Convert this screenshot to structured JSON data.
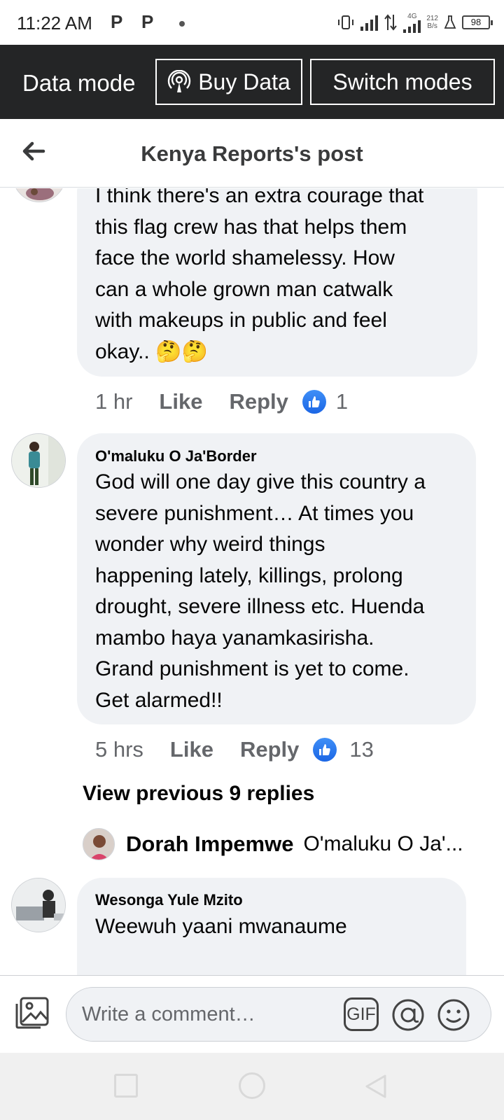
{
  "status_bar": {
    "time": "11:22 AM",
    "notif_icons": [
      "P",
      "P"
    ],
    "network_type": "4G",
    "speed_value": "212",
    "speed_unit": "B/s",
    "battery": "98"
  },
  "data_mode": {
    "label": "Data mode",
    "buy_label": "Buy Data",
    "switch_label": "Switch modes"
  },
  "header": {
    "title": "Kenya Reports's post",
    "back_icon": "arrow-left-icon"
  },
  "comments": [
    {
      "author": "",
      "lines": [
        "I think there's an extra courage that",
        "this flag crew has that helps them",
        "face the world shamelessy. How",
        "can a whole grown man catwalk",
        "with makeups in public and feel",
        "okay.."
      ],
      "emojis": [
        "🤔",
        "🤔"
      ],
      "time": "1 hr",
      "like_label": "Like",
      "reply_label": "Reply",
      "reactions": "1"
    },
    {
      "author": "O'maluku O Ja'Border",
      "lines": [
        "God will one day give this country a",
        "severe punishment… At times you",
        "wonder why weird things",
        "happening lately, killings, prolong",
        "drought, severe illness etc. Huenda",
        "mambo haya yanamkasirisha.",
        "Grand punishment is yet to come.",
        "Get alarmed!!"
      ],
      "time": "5 hrs",
      "like_label": "Like",
      "reply_label": "Reply",
      "reactions": "13"
    },
    {
      "author": "Wesonga Yule Mzito",
      "lines": [
        "Weewuh yaani mwanaume"
      ]
    }
  ],
  "replies": {
    "view_previous": "View previous 9 replies",
    "latest_name": "Dorah Impemwe",
    "latest_text": "O'maluku O Ja'..."
  },
  "composer": {
    "placeholder": "Write a comment…",
    "gif_label": "GIF",
    "at_icon": "mention-icon",
    "emoji_icon": "emoji-icon",
    "photo_icon": "photo-icon"
  },
  "colors": {
    "data_bar": "#242526",
    "bubble": "#f0f2f5",
    "meta_text": "#65676b",
    "like_blue": "#1b66e5"
  }
}
